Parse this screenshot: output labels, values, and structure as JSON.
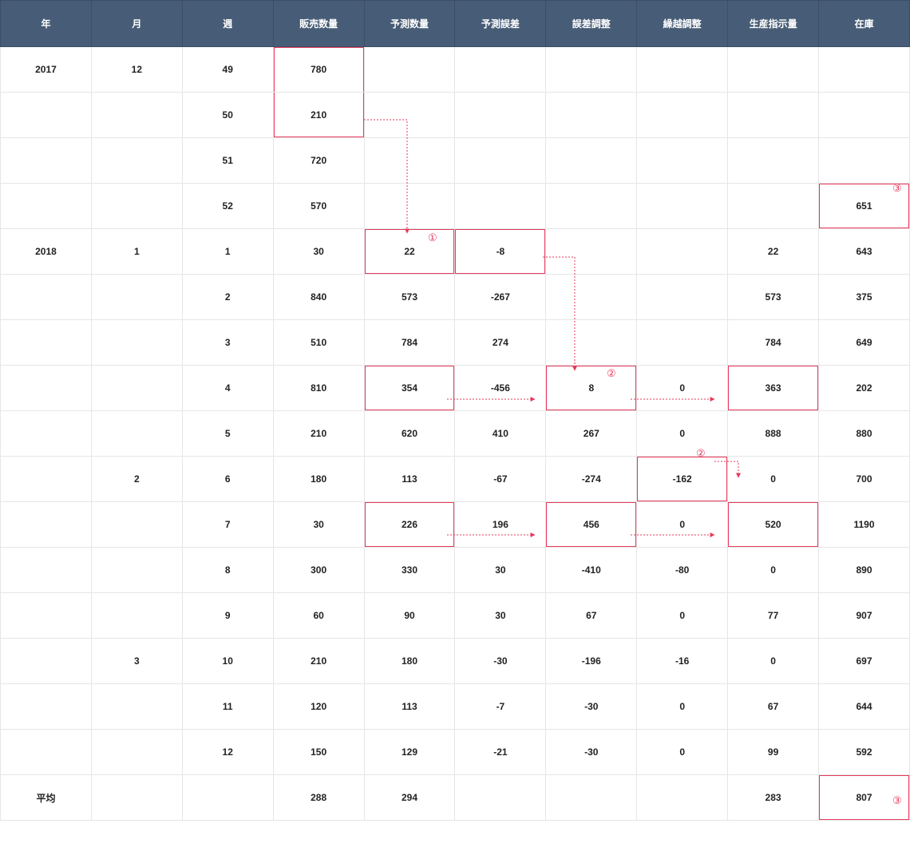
{
  "headers": [
    "年",
    "月",
    "週",
    "販売数量",
    "予測数量",
    "予測誤差",
    "誤差調整",
    "繰越調整",
    "生産指示量",
    "在庫"
  ],
  "rows": [
    {
      "year": "2017",
      "month": "12",
      "week": "49",
      "sales": "780",
      "forecast": "",
      "err": "",
      "adj": "",
      "carry": "",
      "prod": "",
      "stock": ""
    },
    {
      "year": "",
      "month": "",
      "week": "50",
      "sales": "210",
      "forecast": "",
      "err": "",
      "adj": "",
      "carry": "",
      "prod": "",
      "stock": ""
    },
    {
      "year": "",
      "month": "",
      "week": "51",
      "sales": "720",
      "forecast": "",
      "err": "",
      "adj": "",
      "carry": "",
      "prod": "",
      "stock": ""
    },
    {
      "year": "",
      "month": "",
      "week": "52",
      "sales": "570",
      "forecast": "",
      "err": "",
      "adj": "",
      "carry": "",
      "prod": "",
      "stock": "651"
    },
    {
      "year": "2018",
      "month": "1",
      "week": "1",
      "sales": "30",
      "forecast": "22",
      "err": "-8",
      "adj": "",
      "carry": "",
      "prod": "22",
      "stock": "643"
    },
    {
      "year": "",
      "month": "",
      "week": "2",
      "sales": "840",
      "forecast": "573",
      "err": "-267",
      "adj": "",
      "carry": "",
      "prod": "573",
      "stock": "375"
    },
    {
      "year": "",
      "month": "",
      "week": "3",
      "sales": "510",
      "forecast": "784",
      "err": "274",
      "adj": "",
      "carry": "",
      "prod": "784",
      "stock": "649"
    },
    {
      "year": "",
      "month": "",
      "week": "4",
      "sales": "810",
      "forecast": "354",
      "err": "-456",
      "adj": "8",
      "carry": "0",
      "prod": "363",
      "stock": "202"
    },
    {
      "year": "",
      "month": "",
      "week": "5",
      "sales": "210",
      "forecast": "620",
      "err": "410",
      "adj": "267",
      "carry": "0",
      "prod": "888",
      "stock": "880"
    },
    {
      "year": "",
      "month": "2",
      "week": "6",
      "sales": "180",
      "forecast": "113",
      "err": "-67",
      "adj": "-274",
      "carry": "-162",
      "prod": "0",
      "stock": "700"
    },
    {
      "year": "",
      "month": "",
      "week": "7",
      "sales": "30",
      "forecast": "226",
      "err": "196",
      "adj": "456",
      "carry": "0",
      "prod": "520",
      "stock": "1190"
    },
    {
      "year": "",
      "month": "",
      "week": "8",
      "sales": "300",
      "forecast": "330",
      "err": "30",
      "adj": "-410",
      "carry": "-80",
      "prod": "0",
      "stock": "890"
    },
    {
      "year": "",
      "month": "",
      "week": "9",
      "sales": "60",
      "forecast": "90",
      "err": "30",
      "adj": "67",
      "carry": "0",
      "prod": "77",
      "stock": "907"
    },
    {
      "year": "",
      "month": "3",
      "week": "10",
      "sales": "210",
      "forecast": "180",
      "err": "-30",
      "adj": "-196",
      "carry": "-16",
      "prod": "0",
      "stock": "697"
    },
    {
      "year": "",
      "month": "",
      "week": "11",
      "sales": "120",
      "forecast": "113",
      "err": "-7",
      "adj": "-30",
      "carry": "0",
      "prod": "67",
      "stock": "644"
    },
    {
      "year": "",
      "month": "",
      "week": "12",
      "sales": "150",
      "forecast": "129",
      "err": "-21",
      "adj": "-30",
      "carry": "0",
      "prod": "99",
      "stock": "592"
    },
    {
      "year": "平均",
      "month": "",
      "week": "",
      "sales": "288",
      "forecast": "294",
      "err": "",
      "adj": "",
      "carry": "",
      "prod": "283",
      "stock": "807"
    }
  ],
  "annotations": {
    "a1": "①",
    "a2": "②",
    "a2b": "②",
    "a3": "③",
    "a3b": "③"
  },
  "colors": {
    "header_bg": "#475c76",
    "accent": "#e6395a"
  },
  "chart_data": {
    "type": "table",
    "title": "",
    "columns": [
      "年",
      "月",
      "週",
      "販売数量",
      "予測数量",
      "予測誤差",
      "誤差調整",
      "繰越調整",
      "生産指示量",
      "在庫"
    ],
    "data": [
      [
        2017,
        12,
        49,
        780,
        null,
        null,
        null,
        null,
        null,
        null
      ],
      [
        null,
        null,
        50,
        210,
        null,
        null,
        null,
        null,
        null,
        null
      ],
      [
        null,
        null,
        51,
        720,
        null,
        null,
        null,
        null,
        null,
        null
      ],
      [
        null,
        null,
        52,
        570,
        null,
        null,
        null,
        null,
        null,
        651
      ],
      [
        2018,
        1,
        1,
        30,
        22,
        -8,
        null,
        null,
        22,
        643
      ],
      [
        null,
        null,
        2,
        840,
        573,
        -267,
        null,
        null,
        573,
        375
      ],
      [
        null,
        null,
        3,
        510,
        784,
        274,
        null,
        null,
        784,
        649
      ],
      [
        null,
        null,
        4,
        810,
        354,
        -456,
        8,
        0,
        363,
        202
      ],
      [
        null,
        null,
        5,
        210,
        620,
        410,
        267,
        0,
        888,
        880
      ],
      [
        null,
        2,
        6,
        180,
        113,
        -67,
        -274,
        -162,
        0,
        700
      ],
      [
        null,
        null,
        7,
        30,
        226,
        196,
        456,
        0,
        520,
        1190
      ],
      [
        null,
        null,
        8,
        300,
        330,
        30,
        -410,
        -80,
        0,
        890
      ],
      [
        null,
        null,
        9,
        60,
        90,
        30,
        67,
        0,
        77,
        907
      ],
      [
        null,
        3,
        10,
        210,
        180,
        -30,
        -196,
        -16,
        0,
        697
      ],
      [
        null,
        null,
        11,
        120,
        113,
        -7,
        -30,
        0,
        67,
        644
      ],
      [
        null,
        null,
        12,
        150,
        129,
        -21,
        -30,
        0,
        99,
        592
      ],
      [
        "平均",
        null,
        null,
        288,
        294,
        null,
        null,
        null,
        283,
        807
      ]
    ]
  }
}
